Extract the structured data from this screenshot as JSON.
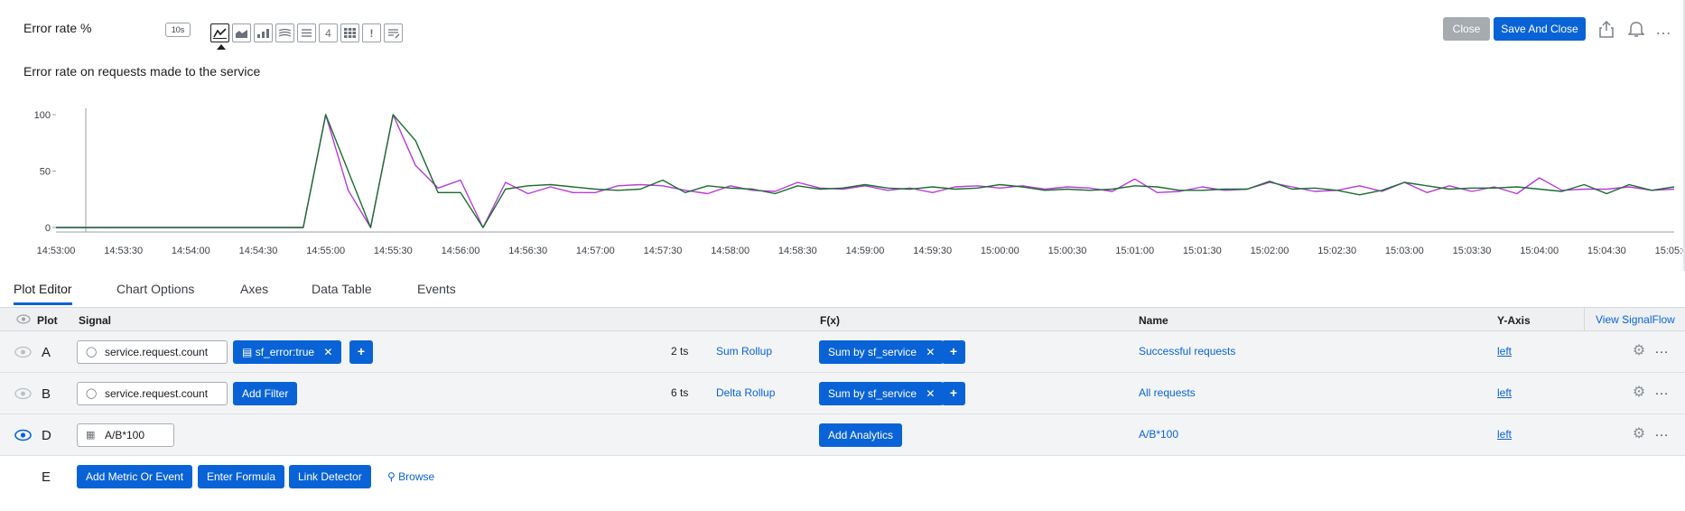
{
  "header": {
    "title": "Error rate %",
    "resolution": "10s",
    "viz_icons": [
      {
        "name": "line-chart-icon",
        "glyph": "",
        "active": true
      },
      {
        "name": "area-chart-icon",
        "glyph": "",
        "active": false
      },
      {
        "name": "column-chart-icon",
        "glyph": "",
        "active": false
      },
      {
        "name": "histogram-icon",
        "glyph": "",
        "active": false
      },
      {
        "name": "list-icon",
        "glyph": "",
        "active": false
      },
      {
        "name": "single-value-icon",
        "glyph": "4",
        "active": false
      },
      {
        "name": "heatmap-icon",
        "glyph": "",
        "active": false
      },
      {
        "name": "event-feed-icon",
        "glyph": "!",
        "active": false
      },
      {
        "name": "text-note-icon",
        "glyph": "",
        "active": false
      }
    ],
    "close_label": "Close",
    "save_label": "Save And Close",
    "more_label": "…"
  },
  "description": "Error rate on requests made to the service",
  "colors": {
    "accent": "#0a63d6",
    "series_a": "#b83bdb",
    "series_b": "#1a6e2e"
  },
  "chart_data": {
    "type": "line",
    "yticks": [
      0,
      50,
      100
    ],
    "ylim": [
      0,
      100
    ],
    "xticks": [
      "14:53:00",
      "14:53:30",
      "14:54:00",
      "14:54:30",
      "14:55:00",
      "14:55:30",
      "14:56:00",
      "14:56:30",
      "14:57:00",
      "14:57:30",
      "14:58:00",
      "14:58:30",
      "14:59:00",
      "14:59:30",
      "15:00:00",
      "15:00:30",
      "15:01:00",
      "15:01:30",
      "15:02:00",
      "15:02:30",
      "15:03:00",
      "15:03:30",
      "15:04:00",
      "15:04:30",
      "15:05:00"
    ],
    "x_start": "14:53:00",
    "x_end": "15:05:00",
    "series": [
      {
        "color": "#b83bdb",
        "points": [
          [
            "14:53:00",
            0
          ],
          [
            "14:54:50",
            0
          ],
          [
            "14:55:00",
            100
          ],
          [
            "14:55:10",
            33
          ],
          [
            "14:55:20",
            0
          ],
          [
            "14:55:30",
            100
          ],
          [
            "14:55:40",
            55
          ],
          [
            "14:55:50",
            35
          ],
          [
            "14:56:00",
            42
          ],
          [
            "14:56:10",
            0
          ],
          [
            "14:56:20",
            40
          ],
          [
            "14:56:30",
            30
          ],
          [
            "14:56:40",
            36
          ],
          [
            "14:56:50",
            31
          ],
          [
            "14:57:00",
            31
          ],
          [
            "14:57:10",
            37
          ],
          [
            "14:57:20",
            38
          ],
          [
            "14:57:30",
            37
          ],
          [
            "14:57:40",
            33
          ],
          [
            "14:57:50",
            30
          ],
          [
            "14:58:00",
            37
          ],
          [
            "14:58:10",
            33
          ],
          [
            "14:58:20",
            32
          ],
          [
            "14:58:30",
            40
          ],
          [
            "14:58:40",
            35
          ],
          [
            "14:58:50",
            34
          ],
          [
            "14:59:00",
            37
          ],
          [
            "14:59:10",
            33
          ],
          [
            "14:59:20",
            35
          ],
          [
            "14:59:30",
            31
          ],
          [
            "14:59:40",
            36
          ],
          [
            "14:59:50",
            37
          ],
          [
            "15:00:00",
            35
          ],
          [
            "15:00:10",
            37
          ],
          [
            "15:00:20",
            34
          ],
          [
            "15:00:30",
            36
          ],
          [
            "15:00:40",
            35
          ],
          [
            "15:00:50",
            32
          ],
          [
            "15:01:00",
            43
          ],
          [
            "15:01:10",
            31
          ],
          [
            "15:01:20",
            32
          ],
          [
            "15:01:30",
            36
          ],
          [
            "15:01:40",
            33
          ],
          [
            "15:01:50",
            34
          ],
          [
            "15:02:00",
            40
          ],
          [
            "15:02:10",
            36
          ],
          [
            "15:02:20",
            32
          ],
          [
            "15:02:30",
            33
          ],
          [
            "15:02:40",
            37
          ],
          [
            "15:02:50",
            32
          ],
          [
            "15:03:00",
            40
          ],
          [
            "15:03:10",
            31
          ],
          [
            "15:03:20",
            37
          ],
          [
            "15:03:30",
            32
          ],
          [
            "15:03:40",
            36
          ],
          [
            "15:03:50",
            30
          ],
          [
            "15:04:00",
            44
          ],
          [
            "15:04:10",
            33
          ],
          [
            "15:04:20",
            34
          ],
          [
            "15:04:30",
            34
          ],
          [
            "15:04:40",
            36
          ],
          [
            "15:04:50",
            33
          ],
          [
            "15:05:00",
            34
          ]
        ]
      },
      {
        "color": "#1a6e2e",
        "points": [
          [
            "14:53:00",
            0
          ],
          [
            "14:54:50",
            0
          ],
          [
            "14:55:00",
            100
          ],
          [
            "14:55:10",
            50
          ],
          [
            "14:55:20",
            0
          ],
          [
            "14:55:30",
            100
          ],
          [
            "14:55:40",
            77
          ],
          [
            "14:55:50",
            31
          ],
          [
            "14:56:00",
            31
          ],
          [
            "14:56:10",
            0
          ],
          [
            "14:56:20",
            34
          ],
          [
            "14:56:30",
            37
          ],
          [
            "14:56:40",
            38
          ],
          [
            "14:56:50",
            36
          ],
          [
            "14:57:00",
            34
          ],
          [
            "14:57:10",
            33
          ],
          [
            "14:57:20",
            34
          ],
          [
            "14:57:30",
            42
          ],
          [
            "14:57:40",
            31
          ],
          [
            "14:57:50",
            37
          ],
          [
            "14:58:00",
            35
          ],
          [
            "14:58:10",
            34
          ],
          [
            "14:58:20",
            30
          ],
          [
            "14:58:30",
            37
          ],
          [
            "14:58:40",
            34
          ],
          [
            "14:58:50",
            35
          ],
          [
            "14:59:00",
            38
          ],
          [
            "14:59:10",
            35
          ],
          [
            "14:59:20",
            34
          ],
          [
            "14:59:30",
            36
          ],
          [
            "14:59:40",
            34
          ],
          [
            "14:59:50",
            35
          ],
          [
            "15:00:00",
            38
          ],
          [
            "15:00:10",
            36
          ],
          [
            "15:00:20",
            33
          ],
          [
            "15:00:30",
            34
          ],
          [
            "15:00:40",
            33
          ],
          [
            "15:00:50",
            34
          ],
          [
            "15:01:00",
            37
          ],
          [
            "15:01:10",
            36
          ],
          [
            "15:01:20",
            33
          ],
          [
            "15:01:30",
            33
          ],
          [
            "15:01:40",
            34
          ],
          [
            "15:01:50",
            34
          ],
          [
            "15:02:00",
            41
          ],
          [
            "15:02:10",
            34
          ],
          [
            "15:02:20",
            35
          ],
          [
            "15:02:30",
            33
          ],
          [
            "15:02:40",
            29
          ],
          [
            "15:02:50",
            33
          ],
          [
            "15:03:00",
            40
          ],
          [
            "15:03:10",
            37
          ],
          [
            "15:03:20",
            34
          ],
          [
            "15:03:30",
            35
          ],
          [
            "15:03:40",
            35
          ],
          [
            "15:03:50",
            36
          ],
          [
            "15:04:00",
            34
          ],
          [
            "15:04:10",
            32
          ],
          [
            "15:04:20",
            38
          ],
          [
            "15:04:30",
            30
          ],
          [
            "15:04:40",
            38
          ],
          [
            "15:04:50",
            33
          ],
          [
            "15:05:00",
            36
          ]
        ]
      }
    ]
  },
  "tabs": [
    {
      "label": "Plot Editor",
      "active": true
    },
    {
      "label": "Chart Options",
      "active": false
    },
    {
      "label": "Axes",
      "active": false
    },
    {
      "label": "Data Table",
      "active": false
    },
    {
      "label": "Events",
      "active": false
    }
  ],
  "table": {
    "headers": {
      "plot": "Plot",
      "signal": "Signal",
      "fx": "F(x)",
      "name": "Name",
      "yaxis": "Y-Axis"
    },
    "view_signalflow": "View SignalFlow",
    "rows": [
      {
        "letter": "A",
        "visible": false,
        "signal": "service.request.count",
        "filter": "sf_error:true",
        "ts": "2 ts",
        "rollup": "Sum Rollup",
        "analytics": "Sum by sf_service",
        "name": "Successful requests",
        "yaxis": "left"
      },
      {
        "letter": "B",
        "visible": false,
        "signal": "service.request.count",
        "add_filter": "Add Filter",
        "ts": "6 ts",
        "rollup": "Delta Rollup",
        "analytics": "Sum by sf_service",
        "name": "All requests",
        "yaxis": "left"
      },
      {
        "letter": "D",
        "visible": true,
        "formula": "A/B*100",
        "add_analytics": "Add Analytics",
        "name": "A/B*100",
        "yaxis": "left"
      }
    ],
    "new_row": {
      "letter": "E",
      "add_metric": "Add Metric Or Event",
      "enter_formula": "Enter Formula",
      "link_detector": "Link Detector",
      "browse": "Browse"
    }
  }
}
